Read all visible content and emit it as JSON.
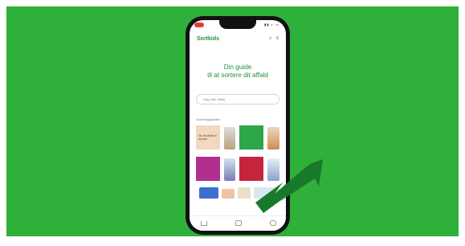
{
  "app": {
    "brand": "Sortkids",
    "headline_line1": "Din guide",
    "headline_line2": "til at sortere dit affald",
    "search_placeholder": "Søg efter affald",
    "section_label": "Sorteringsguides",
    "card_text": "Giv dit affald en ny start"
  },
  "colors": {
    "background": "#2fb03a",
    "brand_green": "#2a8d3a",
    "arrow": "#167a2a"
  },
  "icons": [
    "search-icon",
    "menu-icon",
    "home-icon",
    "heart-icon",
    "user-icon",
    "arrow-pointer"
  ]
}
